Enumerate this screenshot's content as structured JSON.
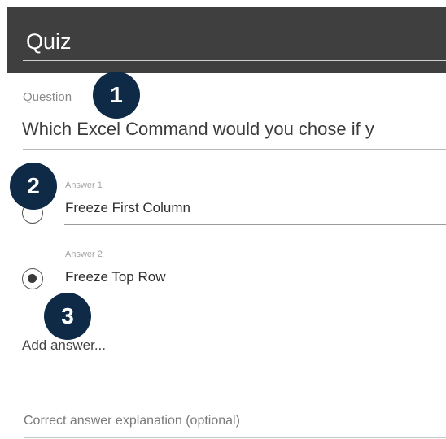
{
  "header": {
    "title": "Quiz"
  },
  "question": {
    "label": "Question",
    "text": "Which Excel Command would you chose if y"
  },
  "answers": [
    {
      "label": "Answer 1",
      "text": "Freeze First Column",
      "selected": false
    },
    {
      "label": "Answer 2",
      "text": "Freeze Top Row",
      "selected": true
    }
  ],
  "add_answer": {
    "label": "Add answer..."
  },
  "explanation": {
    "placeholder": "Correct answer explanation (optional)"
  },
  "callouts": [
    "1",
    "2",
    "3"
  ],
  "colors": {
    "header_bg": "#3f3f3f",
    "callout_bg": "#0e2a47"
  }
}
